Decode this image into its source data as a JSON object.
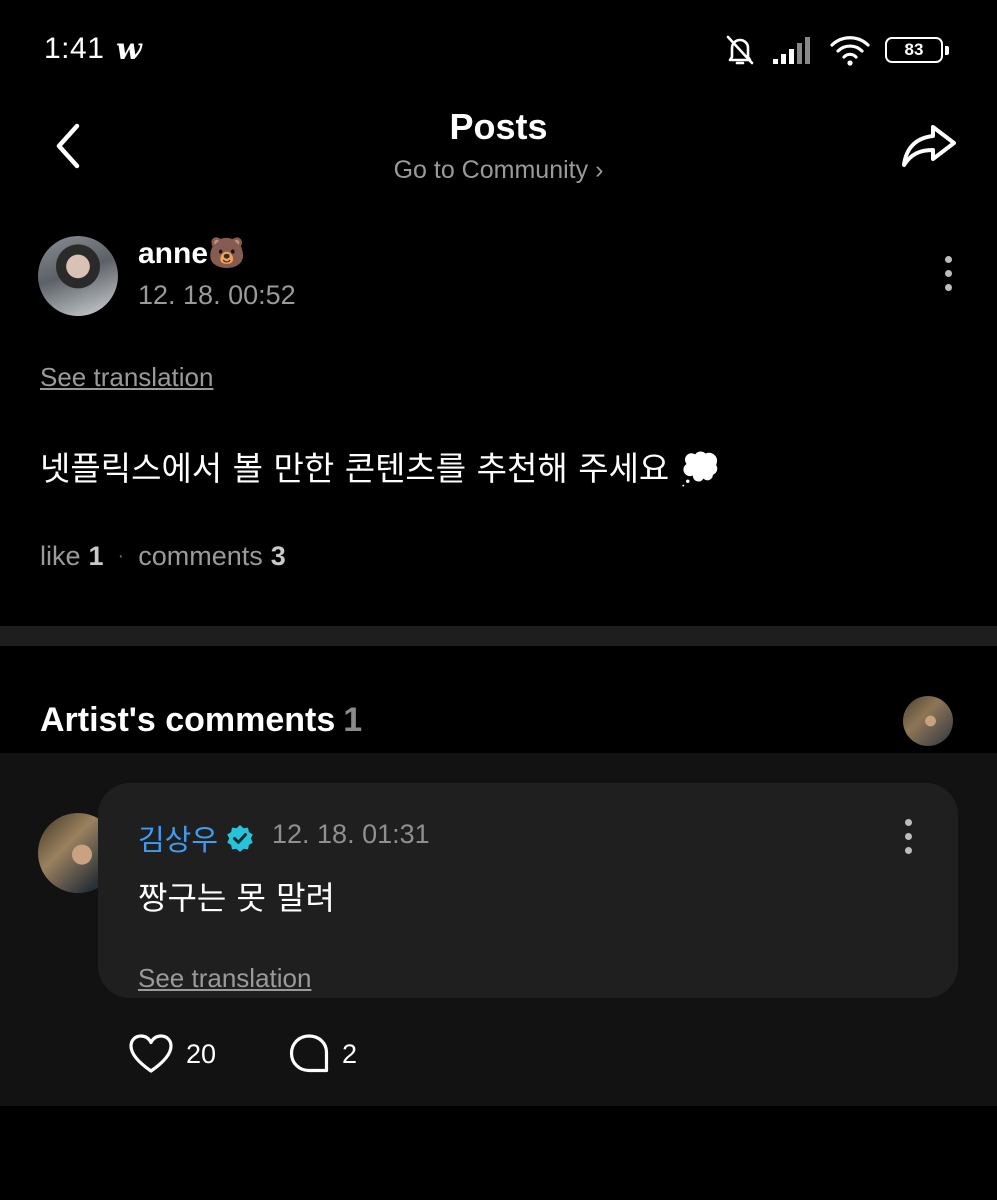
{
  "status_bar": {
    "time": "1:41",
    "app_icon": "w",
    "battery": "83",
    "icons": [
      "bell-muted-icon",
      "signal-icon",
      "wifi-icon",
      "battery-icon"
    ]
  },
  "header": {
    "title": "Posts",
    "subtitle": "Go to Community",
    "subtitle_chevron": "›"
  },
  "post": {
    "author_name": "anne🐻",
    "date": "12. 18. 00:52",
    "see_translation": "See translation",
    "body": "넷플릭스에서 볼 만한 콘텐츠를 추천해 주세요 💭",
    "like_label": "like",
    "like_count": "1",
    "stat_separator": "·",
    "comments_label": "comments",
    "comments_count": "3"
  },
  "artist_comments": {
    "title": "Artist's comments",
    "count": "1",
    "items": [
      {
        "name": "김상우",
        "verified": true,
        "date": "12. 18. 01:31",
        "text": "짱구는 못 말려",
        "see_translation": "See translation",
        "likes": "20",
        "replies": "2"
      }
    ]
  },
  "colors": {
    "background": "#000000",
    "panel": "#121212",
    "bubble": "#1f1f1f",
    "artist_name": "#3f9cf2",
    "verified_badge": "#28c3d8",
    "muted_text": "#9a9a9a"
  }
}
